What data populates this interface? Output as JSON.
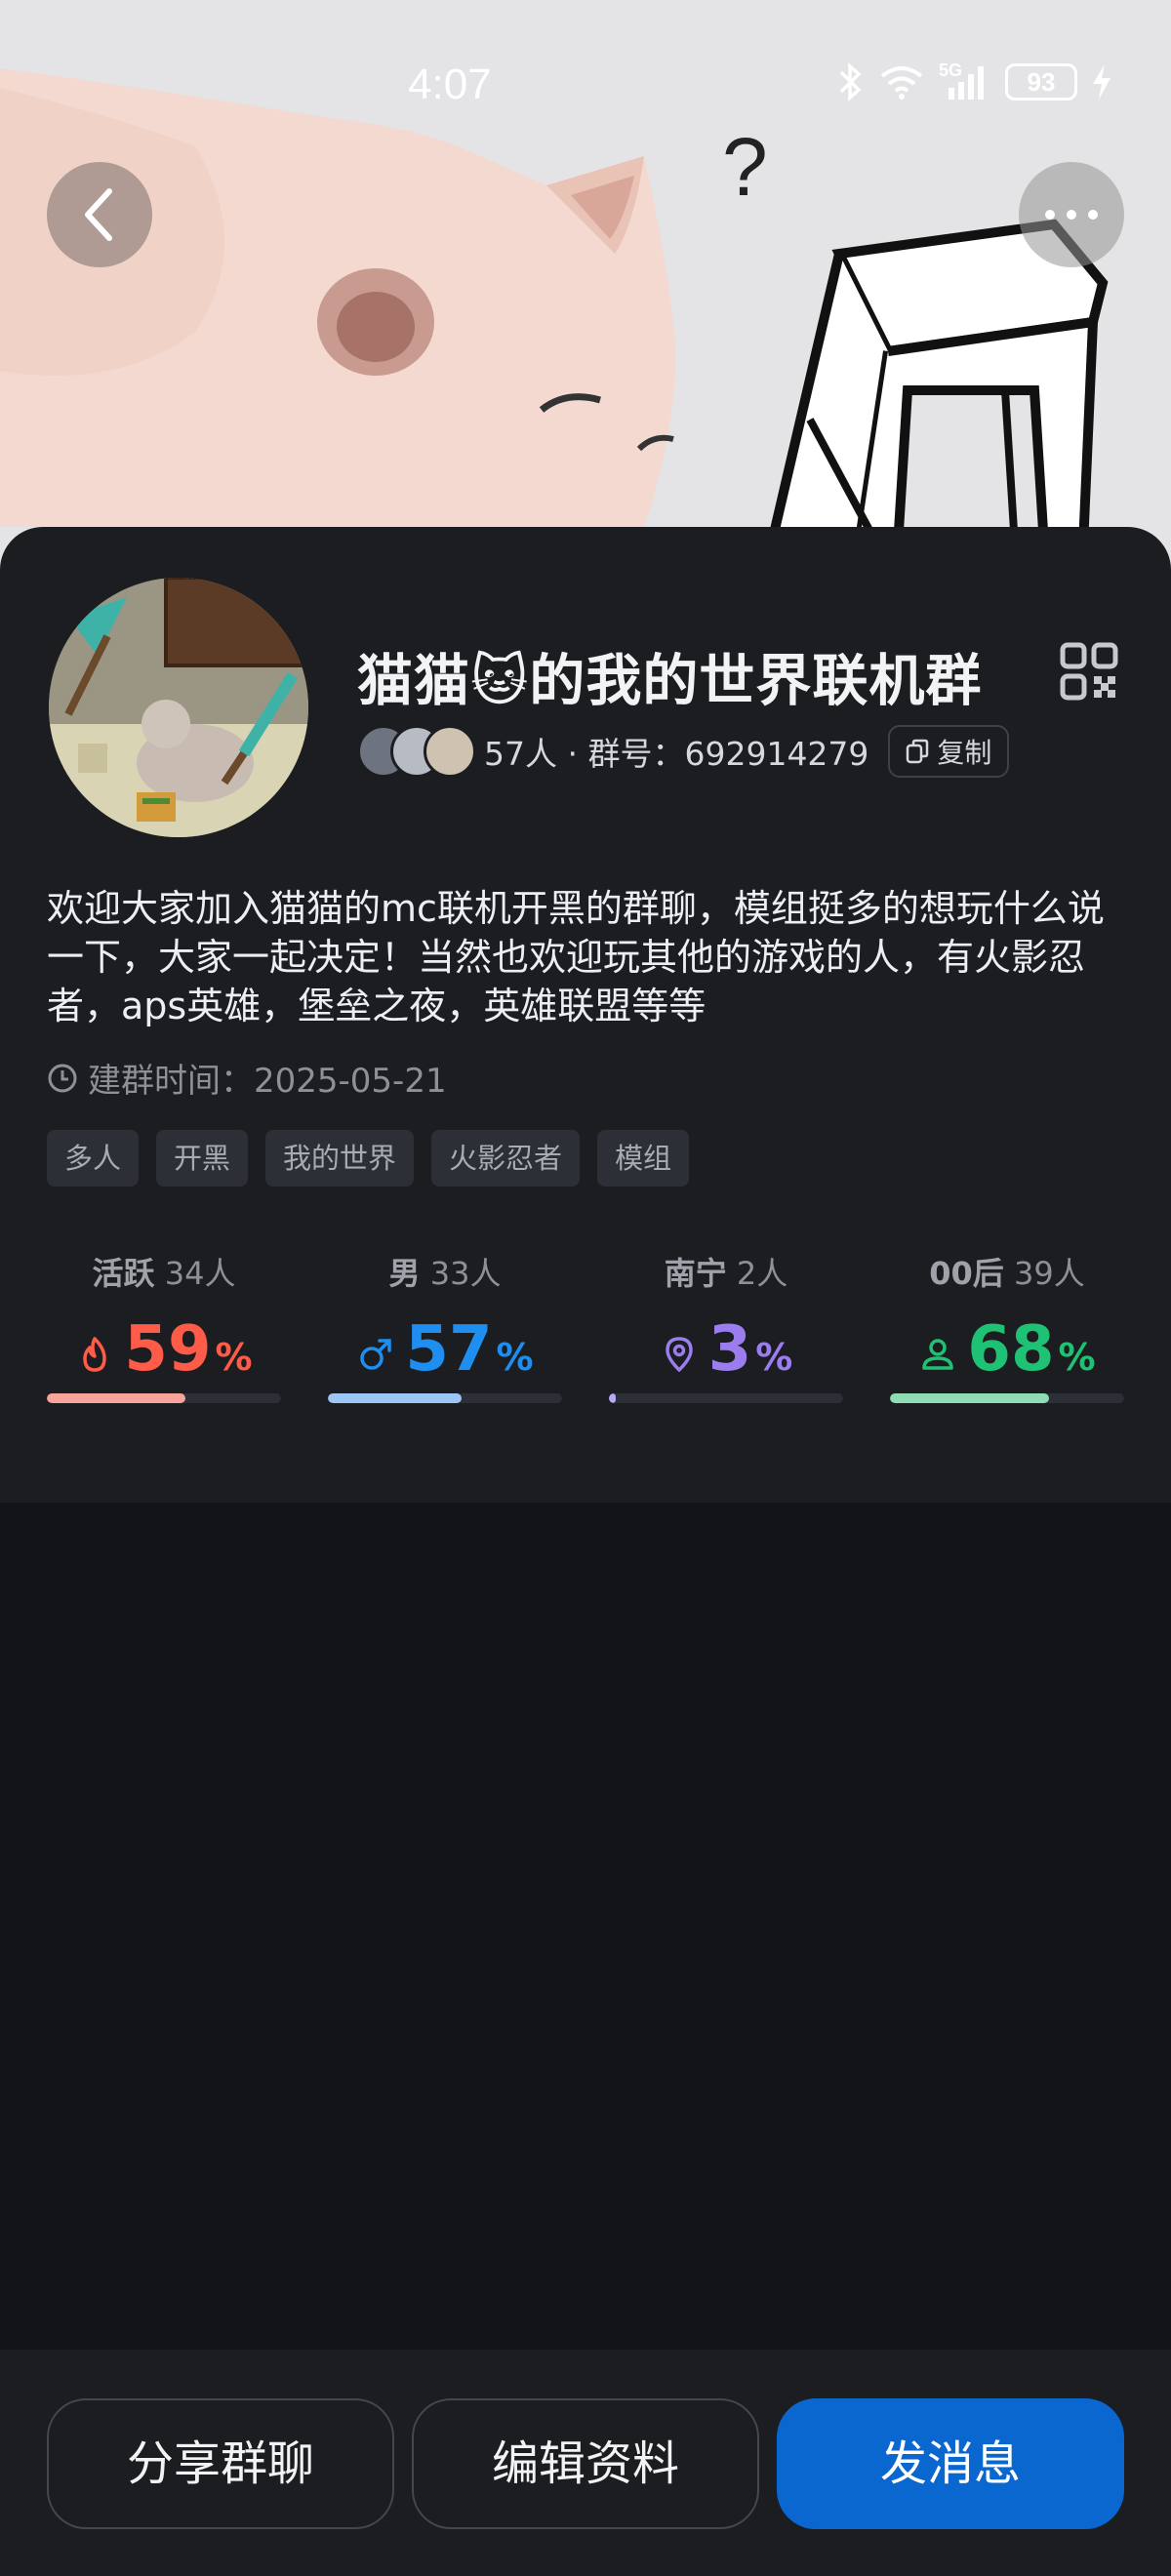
{
  "status_bar": {
    "time": "4:07",
    "network_label": "5G",
    "battery": "93",
    "icons": [
      "bluetooth-icon",
      "wifi-icon",
      "signal-icon",
      "battery-icon",
      "charging-icon"
    ]
  },
  "header": {
    "question_mark": "?"
  },
  "group": {
    "name": "猫猫🐱的我的世界联机群",
    "member_info": "57人 · 群号：692914279",
    "copy_label": "复制",
    "description": "欢迎大家加入猫猫的mc联机开黑的群聊，模组挺多的想玩什么说一下，大家一起决定！当然也欢迎玩其他的游戏的人，有火影忍者，aps英雄，堡垒之夜，英雄联盟等等",
    "created_label": "建群时间：",
    "created_date": "2025-05-21",
    "tags": [
      "多人",
      "开黑",
      "我的世界",
      "火影忍者",
      "模组"
    ]
  },
  "stats": [
    {
      "label": "活跃",
      "count": "34人",
      "value": "59",
      "unit": "%",
      "fraction": 0.59,
      "color": "#ff5b49",
      "bar_color": "#f8a49a",
      "icon": "flame-icon"
    },
    {
      "label": "男",
      "count": "33人",
      "value": "57",
      "unit": "%",
      "fraction": 0.57,
      "color": "#1e8ff0",
      "bar_color": "#9cc6f5",
      "icon": "male-icon"
    },
    {
      "label": "南宁",
      "count": "2人",
      "value": "3",
      "unit": "%",
      "fraction": 0.03,
      "color": "#9b7df0",
      "bar_color": "#b9a8f3",
      "icon": "location-pin-icon"
    },
    {
      "label": "00后",
      "count": "39人",
      "value": "68",
      "unit": "%",
      "fraction": 0.68,
      "color": "#1fc274",
      "bar_color": "#8fdcb2",
      "icon": "person-icon"
    }
  ],
  "actions": {
    "share": "分享群聊",
    "edit": "编辑资料",
    "send": "发消息"
  }
}
